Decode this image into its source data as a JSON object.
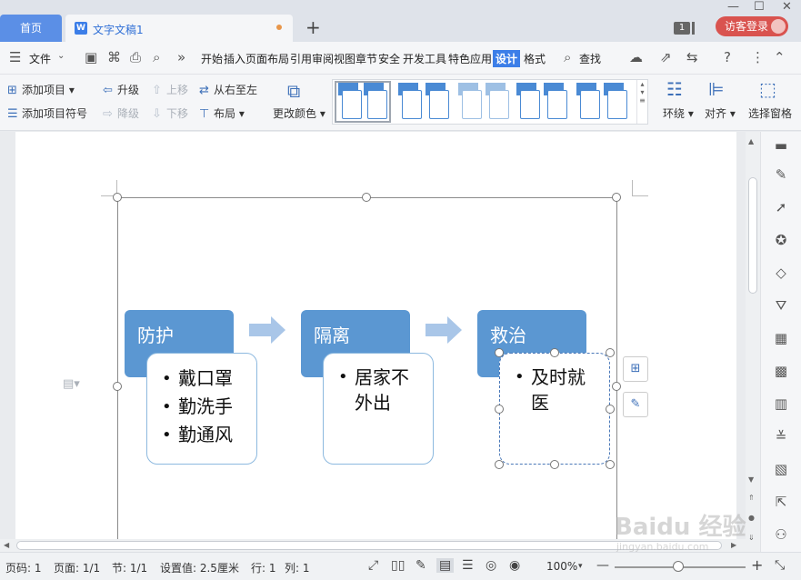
{
  "titlebar": {
    "home_tab": "首页",
    "doc_tab": "文字文稿1",
    "new_tab": "+",
    "badge_number": "1",
    "login": "访客登录",
    "minimize": "—",
    "maximize": "☐",
    "close": "✕"
  },
  "menu": {
    "file": "文件",
    "more": "»",
    "items": [
      "开始",
      "插入",
      "页面布局",
      "引用",
      "审阅",
      "视图",
      "章节",
      "安全",
      "开发工具",
      "特色应用",
      "设计",
      "格式"
    ],
    "active": "设计",
    "search": "查找"
  },
  "ribbon": {
    "add_item": "添加项目",
    "add_bullet": "添加项目符号",
    "promote": "升级",
    "demote": "降级",
    "move_up": "上移",
    "move_down": "下移",
    "rtl": "从右至左",
    "layout": "布局",
    "change_color": "更改颜色",
    "wrap": "环绕",
    "align": "对齐",
    "select_pane": "选择窗格"
  },
  "smartart": {
    "stages": [
      {
        "title": "防护",
        "bullets": [
          "戴口罩",
          "勤洗手",
          "勤通风"
        ]
      },
      {
        "title": "隔离",
        "bullets": [
          "居家不外出"
        ]
      },
      {
        "title": "救治",
        "bullets": [
          "及时就医"
        ]
      }
    ],
    "header_color": "#5b97d2",
    "arrow_color": "#a9c6e8",
    "box_border_color": "#8db9df"
  },
  "status": {
    "page_no": "页码: 1",
    "pages": "页面: 1/1",
    "section": "节: 1/1",
    "setting": "设置值: 2.5厘米",
    "row": "行: 1",
    "col": "列: 1",
    "zoom": "100%"
  },
  "watermark": {
    "logo": "Baidu 经验",
    "url": "jingyan.baidu.com"
  },
  "colors": {
    "accent": "#3c7ee8",
    "home_tab": "#5b8fe6",
    "login": "#d9534f"
  }
}
